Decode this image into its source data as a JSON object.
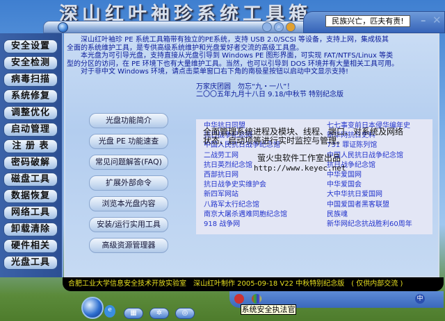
{
  "app": {
    "title": "深山红叶袖珍系统工具箱",
    "motto": "民族兴亡，匹夫有责!",
    "minimize": "–",
    "close": "✕"
  },
  "sidebar": [
    "安全设置",
    "安全检测",
    "病毒扫描",
    "系统修复",
    "调整优化",
    "启动管理",
    "注 册 表",
    "密码破解",
    "磁盘工具",
    "数据恢复",
    "网络工具",
    "卸载清除",
    "硬件相关",
    "光盘工具"
  ],
  "intro": {
    "lines": [
      "　　深山红叶袖珍 PE 系统工具箱带有独立的PE系统，支持 USB 2.0/SCSI 等设备，支持上网，集成极其",
      "全面的系统维护工具，是专供高级系统维护和光盘爱好者交流的高级工具盘。",
      "　　本光盘为可引导光盘，支持直接从光盘引导到 Windows PE 图形界面，可实现 FAT/NTFS/Linux 等类",
      "型的分区的访问，在 PE 环境下也有大量维护工具。当然，也可以引导到 DOS 环境并有大量相关工具可用。",
      "　　对于非中文 Windows 环境，请点击菜单窗口右下角的南极星按钮以启动中文显示支持!"
    ],
    "slogan": "万家庆团圆　勿忘“九・一八”！",
    "date": "二〇〇五年九月十八日 9.18/中秋节 特别纪念版"
  },
  "center_buttons": [
    "光盘功能简介",
    "光盘 PE 功能速查",
    "常见问题解答(FAQ)",
    "扩展外部命令",
    "浏览本光盘内容",
    "安装/运行实用工具",
    "高级资源管理器"
  ],
  "links_left": [
    "中华抗日同盟",
    "抗日战争纪念网",
    "中国人民抗日战争纪念馆",
    "二战劳工网",
    "抗日英烈纪念馆",
    "西部抗日网",
    "抗日战争史实维护会",
    "新四军网站",
    "八路军太行纪念馆",
    "南京大屠杀遇难同胞纪念馆",
    "918 战争网"
  ],
  "links_right": [
    "七七事变前日本侵华编年史",
    "新华网抗日史料",
    "731 罪证陈列馆",
    "中国人民抗日战争纪念馆",
    "抗日战争纪念馆",
    "中华爱国网",
    "中华爱国会",
    "大中华抗日爱国网",
    "中国爱国者黑客联盟",
    "民族魂",
    "新华网纪念抗战胜利60周年"
  ],
  "overlay": {
    "line1": "全面管理系统进程及模块、线程、端口、对系统及网络",
    "line2": "状态、启动项等进行实时监控与管理。",
    "studio": "萤火虫软件工作室出品",
    "url": "http://www.keyec.net"
  },
  "footer": "合肥工业大学信息安全技术开放实验室　深山红叶制作 2005-09-18 V22 中秋特别纪念版　( 仅供内部交流 )",
  "tooltip": "系统安全执法官",
  "tray_icon_cn": "中"
}
